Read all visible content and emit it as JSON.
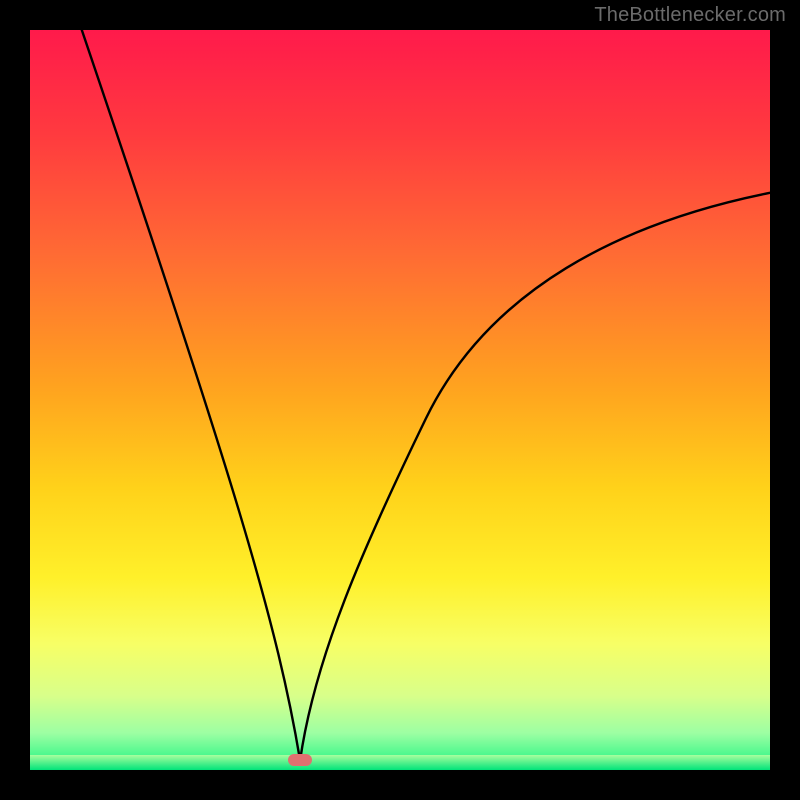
{
  "watermark": "TheBottlenecker.com",
  "chart_data": {
    "type": "line",
    "title": "",
    "xlabel": "",
    "ylabel": "",
    "xlim": [
      0,
      100
    ],
    "ylim": [
      0,
      100
    ],
    "gradient_stops": [
      {
        "pct": 0,
        "color": "#ff1a4b"
      },
      {
        "pct": 14,
        "color": "#ff3a3f"
      },
      {
        "pct": 30,
        "color": "#ff6a34"
      },
      {
        "pct": 48,
        "color": "#ffa21f"
      },
      {
        "pct": 62,
        "color": "#ffd21a"
      },
      {
        "pct": 74,
        "color": "#fff02a"
      },
      {
        "pct": 83,
        "color": "#f7ff66"
      },
      {
        "pct": 90,
        "color": "#d8ff8a"
      },
      {
        "pct": 95,
        "color": "#9dffa3"
      },
      {
        "pct": 98,
        "color": "#4cf88e"
      },
      {
        "pct": 100,
        "color": "#00e37a"
      }
    ],
    "green_band": {
      "from_y": 2,
      "to_y": 0,
      "top_color": "#a8ff9e",
      "bottom_color": "#00e37a"
    },
    "curve": {
      "min_x": 36.5,
      "min_y": 1.3,
      "left_start": {
        "x": 7,
        "y": 100
      },
      "right_end": {
        "x": 100,
        "y": 78
      },
      "left_ctrl": {
        "x": 28,
        "y": 38
      },
      "right_ctrl1": {
        "x": 45,
        "y": 30
      },
      "right_ctrl2": {
        "x": 62,
        "y": 65
      },
      "stroke": "#000000",
      "stroke_width": 2.4
    },
    "marker": {
      "x": 36.5,
      "y": 1.3,
      "color": "#e07070"
    }
  }
}
